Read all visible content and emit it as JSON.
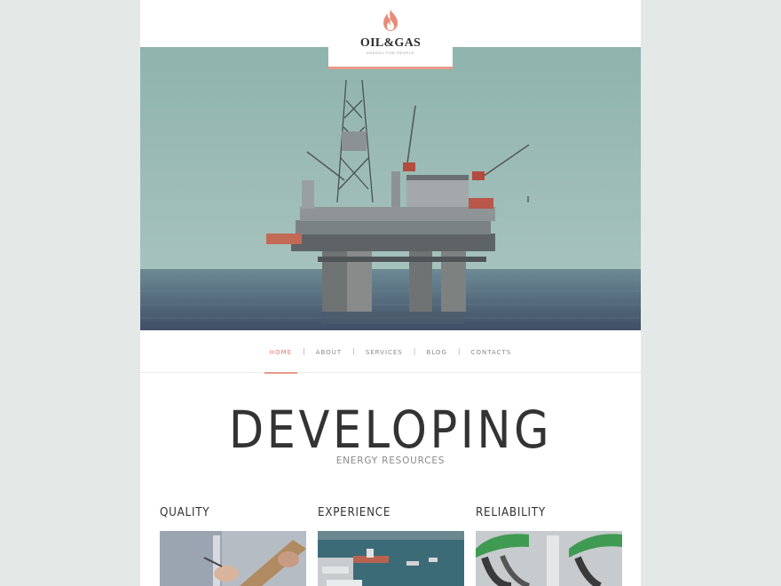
{
  "logo": {
    "title": "OIL&GAS",
    "tagline": "ENERGY FOR PEOPLE",
    "accent": "#e89a8a",
    "icon": "flame-icon"
  },
  "hero": {
    "image": "offshore-oil-platform"
  },
  "nav": {
    "items": [
      {
        "label": "HOME",
        "active": true
      },
      {
        "label": "ABOUT",
        "active": false
      },
      {
        "label": "SERVICES",
        "active": false
      },
      {
        "label": "BLOG",
        "active": false
      },
      {
        "label": "CONTACTS",
        "active": false
      }
    ],
    "separator": "|"
  },
  "intro": {
    "title": "DEVELOPING",
    "subtitle": "ENERGY RESOURCES"
  },
  "features": [
    {
      "title": "QUALITY",
      "image": "hand-writing-clipboard"
    },
    {
      "title": "EXPERIENCE",
      "image": "industrial-harbor"
    },
    {
      "title": "RELIABILITY",
      "image": "fuel-pump-nozzles"
    }
  ]
}
